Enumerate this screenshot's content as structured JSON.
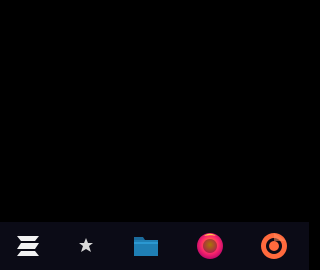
{
  "desktop": {
    "background": "#000000"
  },
  "taskbar": {
    "background": "#0b0b16",
    "items": [
      {
        "icon": "zorin-menu-icon",
        "kind": "app-launcher"
      },
      {
        "icon": "settings-puzzle-icon",
        "kind": "app"
      },
      {
        "icon": "files-folder-icon",
        "kind": "app"
      },
      {
        "icon": "firefox-icon",
        "kind": "app"
      },
      {
        "icon": "chrome-icon",
        "kind": "app"
      }
    ],
    "colors": {
      "folder_blue": "#1f6fa3",
      "firefox_pink": "#ff2a6b",
      "chrome_orange": "#ff6a3d"
    }
  }
}
